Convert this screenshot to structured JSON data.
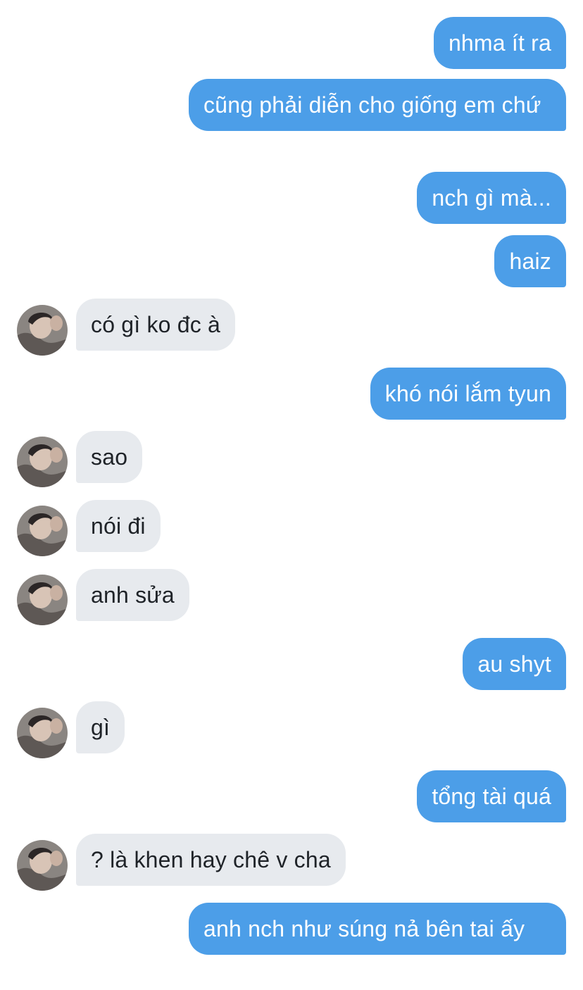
{
  "messages": [
    {
      "side": "out",
      "text": "nhma ít ra"
    },
    {
      "side": "out",
      "text": "cũng phải diễn cho giống em chứ"
    },
    {
      "side": "out",
      "text": "nch gì mà..."
    },
    {
      "side": "out",
      "text": "haiz"
    },
    {
      "side": "in",
      "text": "có gì ko đc à"
    },
    {
      "side": "out",
      "text": "khó nói lắm tyun"
    },
    {
      "side": "in",
      "text": "sao"
    },
    {
      "side": "in",
      "text": "nói đi"
    },
    {
      "side": "in",
      "text": "anh sửa"
    },
    {
      "side": "out",
      "text": "au shyt"
    },
    {
      "side": "in",
      "text": "gì"
    },
    {
      "side": "out",
      "text": "tổng tài quá"
    },
    {
      "side": "in",
      "text": "? là khen hay chê v cha"
    },
    {
      "side": "out",
      "text": "anh nch như súng nả bên tai ấy"
    }
  ],
  "contact": {
    "avatar_icon": "contact-avatar-photo"
  },
  "colors": {
    "outgoing_bubble": "#4c9ee8",
    "incoming_bubble": "#e7eaee",
    "outgoing_text": "#ffffff",
    "incoming_text": "#1f2328",
    "background": "#ffffff"
  }
}
